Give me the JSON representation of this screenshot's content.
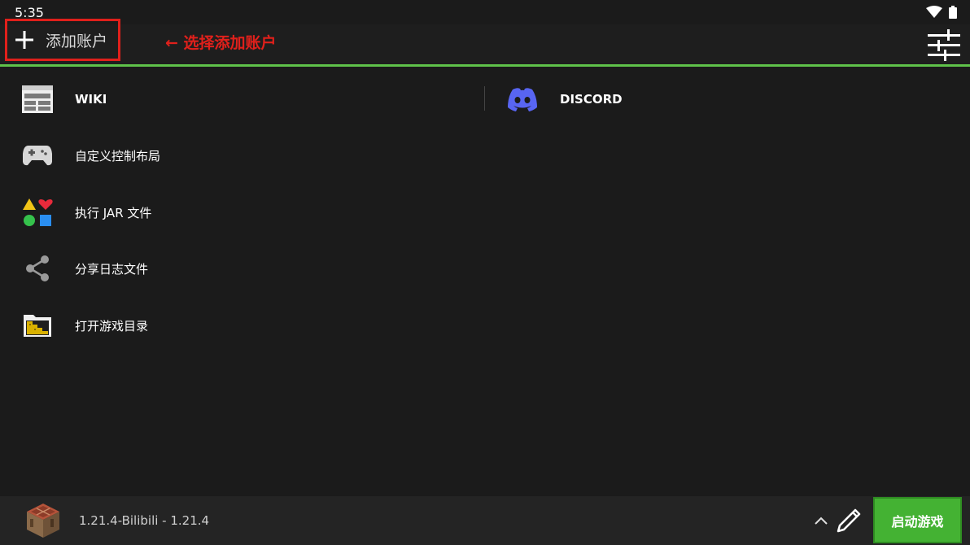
{
  "status_bar": {
    "time": "5:35",
    "icons": [
      "wifi-icon",
      "battery-icon"
    ]
  },
  "header": {
    "add_account_label": "添加账户",
    "annotation": "← 选择添加账户",
    "settings_icon": "sliders-icon"
  },
  "menu": {
    "items": [
      {
        "label": "WIKI",
        "icon": "wiki-icon"
      },
      {
        "label": "DISCORD",
        "icon": "discord-icon"
      },
      {
        "label": "自定义控制布局",
        "icon": "gamepad-icon"
      },
      {
        "label": "执行 JAR 文件",
        "icon": "shapes-icon"
      },
      {
        "label": "分享日志文件",
        "icon": "share-icon"
      },
      {
        "label": "打开游戏目录",
        "icon": "folder-icon"
      }
    ]
  },
  "bottom_bar": {
    "version_label": "1.21.4-Bilibili - 1.21.4",
    "launch_label": "启动游戏"
  },
  "colors": {
    "accent_green": "#5fc24a",
    "launch_green": "#44b233",
    "highlight_red": "#e0201b",
    "discord_blue": "#5865f2",
    "background": "#1b1b1b"
  }
}
